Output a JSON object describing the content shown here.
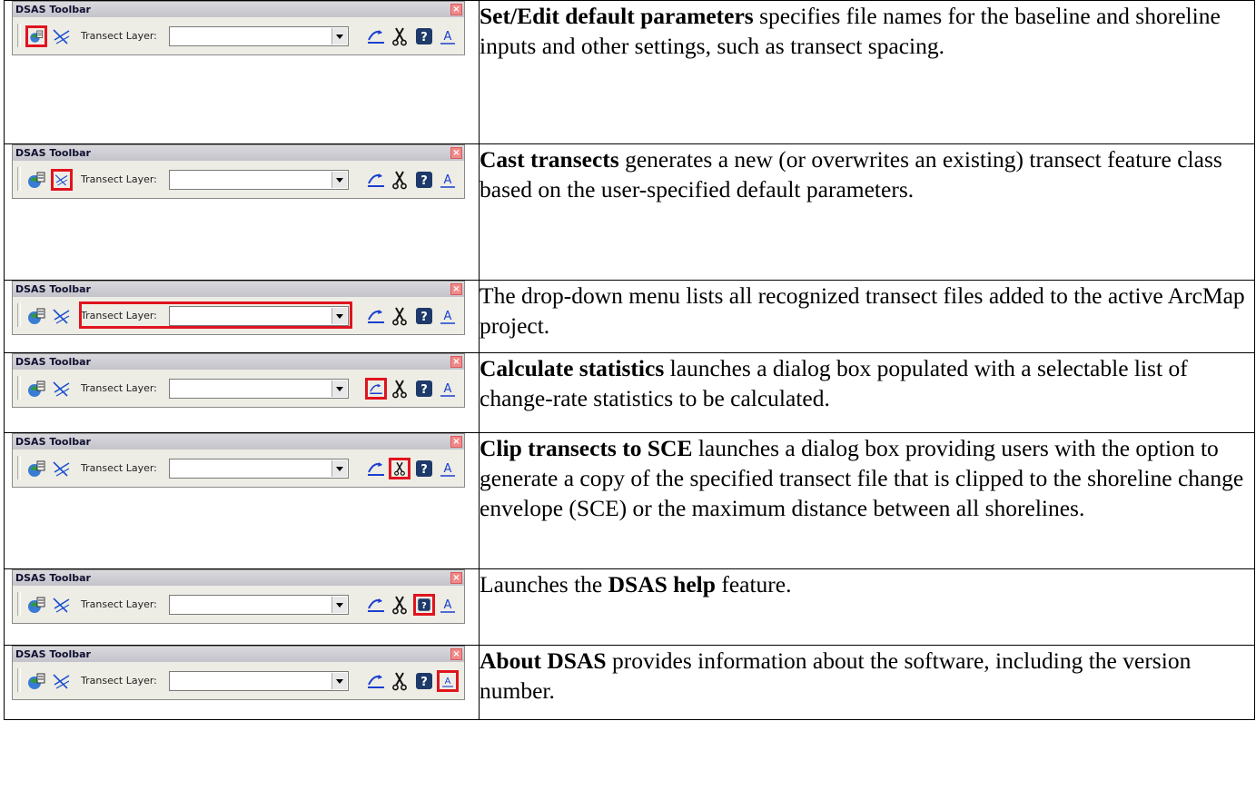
{
  "toolbar": {
    "title": "DSAS Toolbar",
    "layer_label": "Transect Layer:",
    "layer_value": "",
    "icons": {
      "params": "set-edit-parameters-icon",
      "cast": "cast-transects-icon",
      "calc": "calculate-statistics-icon",
      "clip": "clip-transects-icon",
      "help": "help-icon",
      "about": "about-icon"
    },
    "highlight_color": "#e0141e"
  },
  "rows": [
    {
      "highlight": "params",
      "bold": "Set/Edit default parameters",
      "text": " specifies file names for the baseline and shoreline inputs and other settings, such as transect spacing."
    },
    {
      "highlight": "cast",
      "bold": "Cast transects",
      "text": " generates a new (or overwrites an existing) transect feature class based on the user-specified default parameters."
    },
    {
      "highlight": "combo",
      "bold": "",
      "text": "The drop-down menu lists all recognized transect files added to the active ArcMap project."
    },
    {
      "highlight": "calc",
      "bold": "Calculate statistics",
      "text": " launches a dialog box populated with a selectable list of change-rate statistics to be calculated."
    },
    {
      "highlight": "clip",
      "bold": "Clip transects to SCE",
      "text": " launches a dialog box providing users with the option to generate a copy of the specified transect file that is clipped to the shoreline change envelope (SCE) or the maximum distance between all shorelines."
    },
    {
      "highlight": "help",
      "pre": "Launches the ",
      "bold": "DSAS help",
      "text": " feature."
    },
    {
      "highlight": "about",
      "bold": "About DSAS",
      "text": " provides information about the software, including the version number."
    }
  ]
}
